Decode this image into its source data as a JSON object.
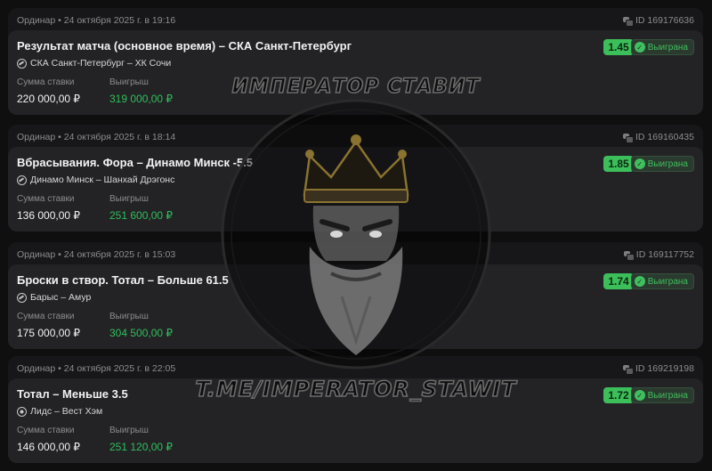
{
  "watermark": {
    "top_text": "ИМПЕРАТОР СТАВИТ",
    "bottom_text": "T.ME/IMPERATOR_STAWIT"
  },
  "colors": {
    "odds_bg": "#3cbf5a",
    "win_value": "#2fbf5a",
    "status_text": "#3fbf5e"
  },
  "labels": {
    "stake": "Сумма ставки",
    "win": "Выигрыш",
    "status": "Выиграна"
  },
  "bets": [
    {
      "meta": "Ординар • 24 октября 2025 г. в 19:16",
      "id": "ID 169176636",
      "title": "Результат матча (основное время) – СКА Санкт-Петербург",
      "match": "СКА Санкт-Петербург – ХК Сочи",
      "sport_icon": "hockey-puck-icon",
      "odds": "1.45",
      "stake": "220 000,00 ₽",
      "win": "319 000,00 ₽"
    },
    {
      "meta": "Ординар • 24 октября 2025 г. в 18:14",
      "id": "ID 169160435",
      "title": "Вбрасывания. Фора – Динамо Минск -5.5",
      "match": "Динамо Минск – Шанхай Дрэгонс",
      "sport_icon": "hockey-puck-icon",
      "odds": "1.85",
      "stake": "136 000,00 ₽",
      "win": "251 600,00 ₽"
    },
    {
      "meta": "Ординар • 24 октября 2025 г. в 15:03",
      "id": "ID 169117752",
      "title": "Броски в створ. Тотал – Больше 61.5",
      "match": "Барыс – Амур",
      "sport_icon": "hockey-puck-icon",
      "odds": "1.74",
      "stake": "175 000,00 ₽",
      "win": "304 500,00 ₽"
    },
    {
      "meta": "Ординар • 24 октября 2025 г. в 22:05",
      "id": "ID 169219198",
      "title": "Тотал – Меньше 3.5",
      "match": "Лидс – Вест Хэм",
      "sport_icon": "soccer-ball-icon",
      "odds": "1.72",
      "stake": "146 000,00 ₽",
      "win": "251 120,00 ₽"
    }
  ]
}
